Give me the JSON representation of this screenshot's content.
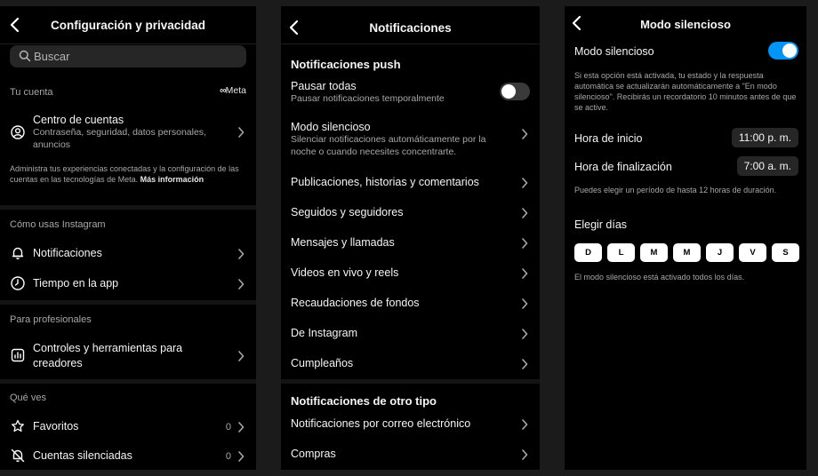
{
  "panel1": {
    "title": "Configuración y privacidad",
    "search_placeholder": "Buscar",
    "account_section": "Tu cuenta",
    "meta_brand": "Meta",
    "accounts_center": {
      "title": "Centro de cuentas",
      "subtitle": "Contraseña, seguridad, datos personales, anuncios"
    },
    "meta_note": "Administra tus experiencias conectadas y la configuración de las cuentas en las tecnologías de Meta.",
    "meta_note_link": "Más información",
    "usage_section": "Cómo usas Instagram",
    "usage_items": [
      {
        "label": "Notificaciones",
        "icon": "bell-icon"
      },
      {
        "label": "Tiempo en la app",
        "icon": "clock-icon"
      }
    ],
    "pro_section": "Para profesionales",
    "pro_item": "Controles y herramientas para creadores",
    "see_section": "Qué ves",
    "see_items": [
      {
        "label": "Favoritos",
        "count": "0",
        "icon": "star-icon"
      },
      {
        "label": "Cuentas silenciadas",
        "count": "0",
        "icon": "muted-bell-icon"
      }
    ]
  },
  "panel2": {
    "title": "Notificaciones",
    "push_section": "Notificaciones push",
    "pause": {
      "title": "Pausar todas",
      "subtitle": "Pausar notificaciones temporalmente",
      "enabled": false
    },
    "quiet": {
      "title": "Modo silencioso",
      "subtitle": "Silenciar notificaciones automáticamente por la noche o cuando necesites concentrarte."
    },
    "items": [
      "Publicaciones, historias y comentarios",
      "Seguidos y seguidores",
      "Mensajes y llamadas",
      "Videos en vivo y reels",
      "Recaudaciones de fondos",
      "De Instagram",
      "Cumpleaños"
    ],
    "other_section": "Notificaciones de otro tipo",
    "other_items": [
      "Notificaciones por correo electrónico",
      "Compras"
    ]
  },
  "panel3": {
    "title": "Modo silencioso",
    "toggle_label": "Modo silencioso",
    "toggle_on": true,
    "description": "Si esta opción está activada, tu estado y la respuesta automática se actualizarán automáticamente a \"En modo silencioso\". Recibirás un recordatorio 10 minutos antes de que se active.",
    "start_label": "Hora de inicio",
    "start_value": "11:00 p. m.",
    "end_label": "Hora de finalización",
    "end_value": "7:00 a. m.",
    "range_note": "Puedes elegir un período de hasta 12 horas de duración.",
    "days_label": "Elegir días",
    "days": [
      "D",
      "L",
      "M",
      "M",
      "J",
      "V",
      "S"
    ],
    "days_note": "El modo silencioso está activado todos los días."
  },
  "colors": {
    "background": "#000000",
    "toggle_on": "#0095f6",
    "secondary_text": "#a8a8a8"
  }
}
